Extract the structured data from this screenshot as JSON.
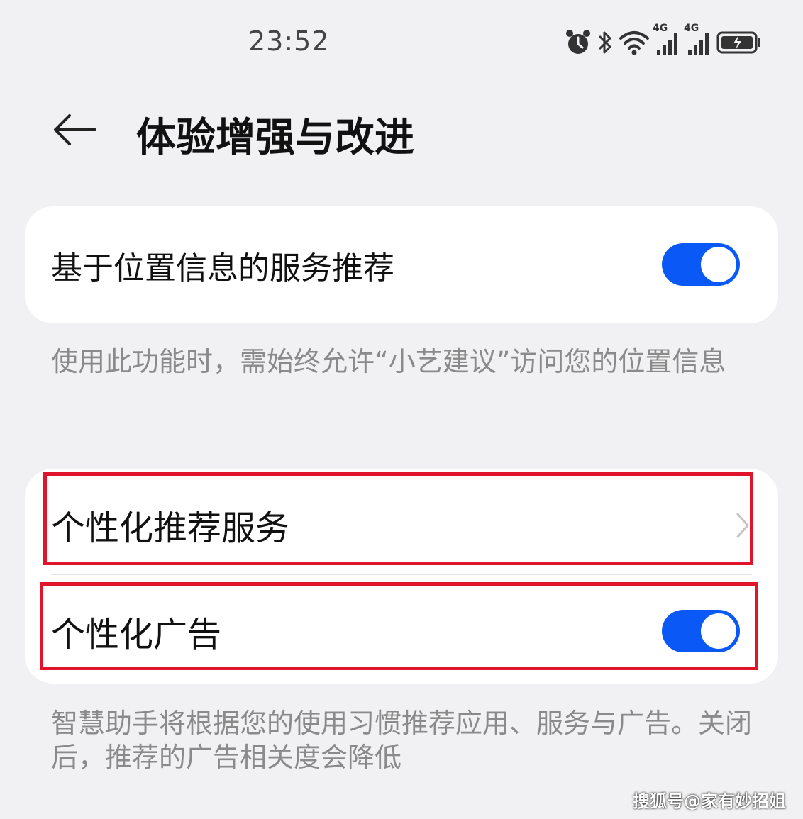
{
  "status_bar": {
    "time": "23:52",
    "network_1": "4G",
    "network_2": "4G",
    "icons": [
      "alarm-icon",
      "bluetooth-icon",
      "wifi-icon",
      "signal-icon",
      "signal-icon",
      "battery-charging-icon"
    ]
  },
  "header": {
    "title": "体验增强与改进",
    "back_icon": "arrow-left-icon"
  },
  "settings": {
    "location_recommend": {
      "label": "基于位置信息的服务推荐",
      "enabled": true,
      "caption": "使用此功能时，需始终允许“小艺建议”访问您的位置信息"
    },
    "personalized_service": {
      "label": "个性化推荐服务",
      "icon": "chevron-right-icon"
    },
    "personalized_ads": {
      "label": "个性化广告",
      "enabled": true,
      "caption": "智慧助手将根据您的使用习惯推荐应用、服务与广告。关闭后，推荐的广告相关度会降低"
    }
  },
  "colors": {
    "accent": "#0a59f7",
    "highlight": "#e0142b",
    "background": "#f1f1f3"
  },
  "watermark": "搜狐号@家有妙招姐"
}
